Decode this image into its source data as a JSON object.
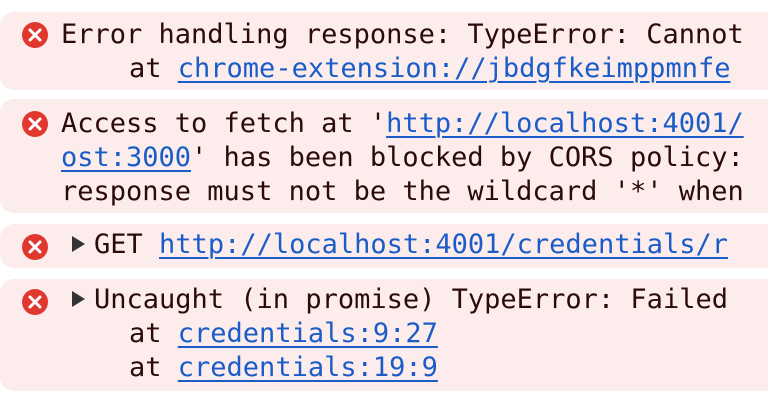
{
  "messages": [
    {
      "level": "error",
      "line1": "Error handling response: TypeError: Cannot",
      "stack_prefix": "at",
      "stack_link": "chrome-extension://jbdgfkeimppmnfe"
    },
    {
      "level": "error",
      "line1_text": "Access to fetch at '",
      "line1_link": "http://localhost:4001/",
      "line2_link": "ost:3000",
      "line2_text": "' has been blocked by CORS policy:",
      "line3_text": "response must not be the wildcard '*' when"
    },
    {
      "level": "error",
      "method": "GET",
      "url": "http://localhost:4001/credentials/r"
    },
    {
      "level": "error",
      "line1": "Uncaught (in promise) TypeError: Failed",
      "stack": [
        {
          "prefix": "at",
          "link": "credentials:9:27"
        },
        {
          "prefix": "at",
          "link": "credentials:19:9"
        }
      ]
    }
  ],
  "colors": {
    "error_background": "#fcecec",
    "error_icon": "#e0382f",
    "link": "#1a5cc8",
    "text": "#2b0a0a"
  },
  "icons": {
    "error": "error-circle-x-icon",
    "expand": "expand-caret-icon"
  }
}
